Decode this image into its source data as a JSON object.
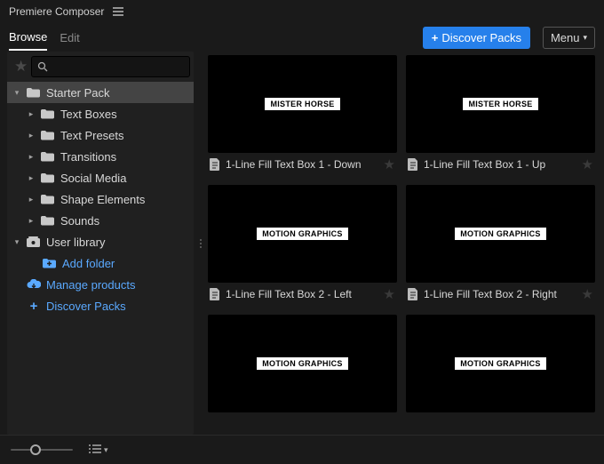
{
  "app_title": "Premiere Composer",
  "tabs": {
    "browse": "Browse",
    "edit": "Edit",
    "active": "browse"
  },
  "header": {
    "discover_label": "Discover Packs",
    "menu_label": "Menu"
  },
  "search": {
    "placeholder": "",
    "value": ""
  },
  "sidebar": {
    "starter_pack": "Starter Pack",
    "children": [
      "Text Boxes",
      "Text Presets",
      "Transitions",
      "Social Media",
      "Shape Elements",
      "Sounds"
    ],
    "user_library": "User library",
    "add_folder": "Add folder",
    "manage_products": "Manage products",
    "discover_packs": "Discover Packs"
  },
  "items": [
    {
      "thumb_text": "MISTER HORSE",
      "caption": "1-Line Fill Text Box 1 - Down"
    },
    {
      "thumb_text": "MISTER HORSE",
      "caption": "1-Line Fill Text Box 1 - Up"
    },
    {
      "thumb_text": "MOTION GRAPHICS",
      "caption": "1-Line Fill Text Box 2 - Left"
    },
    {
      "thumb_text": "MOTION GRAPHICS",
      "caption": "1-Line Fill Text Box 2 - Right"
    },
    {
      "thumb_text": "MOTION GRAPHICS",
      "caption": ""
    },
    {
      "thumb_text": "MOTION GRAPHICS",
      "caption": ""
    }
  ],
  "colors": {
    "accent": "#2680eb"
  }
}
